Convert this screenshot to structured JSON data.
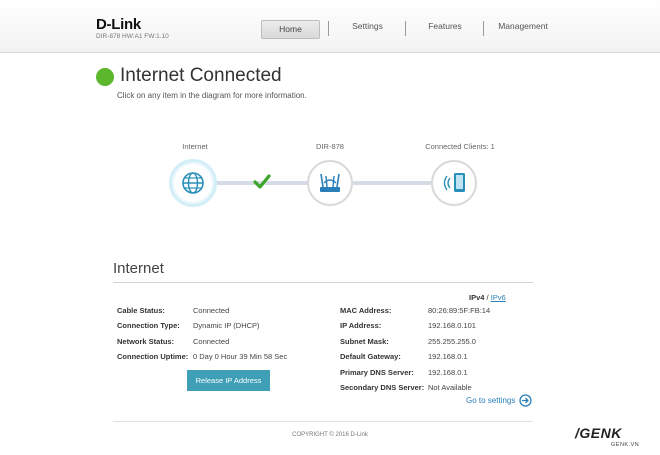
{
  "header": {
    "logo": "D-Link",
    "model": "DIR-878 HW:A1 FW:1.10",
    "nav": [
      {
        "label": "Home"
      },
      {
        "label": "Settings"
      },
      {
        "label": "Features"
      },
      {
        "label": "Management"
      }
    ]
  },
  "status": {
    "title": "Internet Connected",
    "hint": "Click on any item in the diagram for more information."
  },
  "diagram": {
    "internet_label": "Internet",
    "router_label": "DIR-878",
    "clients_label": "Connected Clients: 1"
  },
  "panel": {
    "title": "Internet",
    "ipv4": "IPv4",
    "sep": "/",
    "ipv6": "IPv6",
    "left": [
      {
        "key": "Cable Status:",
        "value": "Connected"
      },
      {
        "key": "Connection Type:",
        "value": "Dynamic IP (DHCP)"
      },
      {
        "key": "Network Status:",
        "value": "Connected"
      },
      {
        "key": "Connection Uptime:",
        "value": "0 Day 0 Hour 39 Min 58 Sec"
      }
    ],
    "right": [
      {
        "key": "MAC Address:",
        "value": "80:26:89:5F:FB:14"
      },
      {
        "key": "IP Address:",
        "value": "192.168.0.101"
      },
      {
        "key": "Subnet Mask:",
        "value": "255.255.255.0"
      },
      {
        "key": "Default Gateway:",
        "value": "192.168.0.1"
      },
      {
        "key": "Primary DNS Server:",
        "value": "192.168.0.1"
      },
      {
        "key": "Secondary DNS Server:",
        "value": "Not Available"
      }
    ],
    "release_button": "Release IP Address",
    "goto_settings": "Go to settings"
  },
  "footer": {
    "copyright": "COPYRIGHT © 2016 D-Link"
  },
  "watermark": {
    "brand": "/GENK",
    "sub": "GENK.VN"
  },
  "colors": {
    "status_green": "#5db72d",
    "accent_teal": "#3e9fb6",
    "link_blue": "#2a7fb8",
    "active_node_ring": "#d2eef9"
  },
  "icons": {
    "internet": "globe-icon",
    "router": "router-icon",
    "clients": "tablet-wifi-icon",
    "link_ok": "checkmark-icon",
    "goto": "arrow-circle-right-icon"
  }
}
